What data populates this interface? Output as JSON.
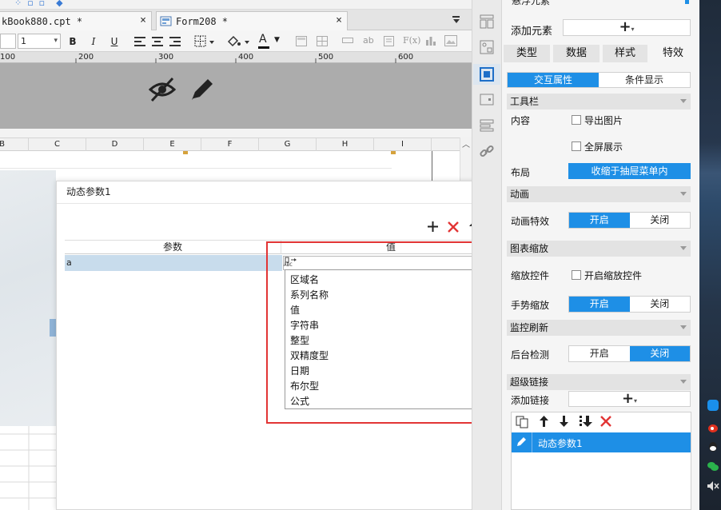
{
  "tabs": [
    {
      "label": "kBook880.cpt *",
      "close": "×"
    },
    {
      "label": "Form208 *",
      "close": "×"
    }
  ],
  "toolbar": {
    "font_size_value": "1",
    "bold": "B",
    "italic": "I",
    "underline": "U",
    "font_color_letter": "A",
    "ab_label": "ab",
    "fx_label": "F(x)"
  },
  "ruler": {
    "labels": [
      "100",
      "200",
      "300",
      "400",
      "500",
      "600"
    ]
  },
  "columns": [
    "B",
    "C",
    "D",
    "E",
    "F",
    "G",
    "H",
    "I"
  ],
  "dialog": {
    "title": "动态参数1",
    "headers": {
      "param": "参数",
      "value": "值"
    },
    "row": {
      "param": "a",
      "type_icon_text": "ABC"
    },
    "options": [
      "区域名",
      "系列名称",
      "值",
      "字符串",
      "整型",
      "双精度型",
      "日期",
      "布尔型",
      "公式"
    ]
  },
  "panel": {
    "top_label": "悬浮元素",
    "add_element_label": "添加元素",
    "plus": "+",
    "tabs": [
      "类型",
      "数据",
      "样式",
      "特效"
    ],
    "subtabs": [
      "交互属性",
      "条件显示"
    ],
    "toolbar_section": "工具栏",
    "content_label": "内容",
    "export_image": "导出图片",
    "fullscreen": "全屏展示",
    "layout_label": "布局",
    "layout_value": "收缩于抽屉菜单内",
    "animation_section": "动画",
    "animation_effect_label": "动画特效",
    "chart_zoom_section": "图表缩放",
    "zoom_control_label": "缩放控件",
    "enable_zoom_control": "开启缩放控件",
    "gesture_zoom_label": "手势缩放",
    "monitor_refresh_section": "监控刷新",
    "backend_detect_label": "后台检测",
    "hyperlink_section": "超级链接",
    "add_link_label": "添加链接",
    "on": "开启",
    "off": "关闭",
    "link_item": "动态参数1"
  },
  "colors": {
    "accent": "#1e8fe6",
    "highlight_box": "#e23535",
    "selected_row": "#c8dcec"
  }
}
